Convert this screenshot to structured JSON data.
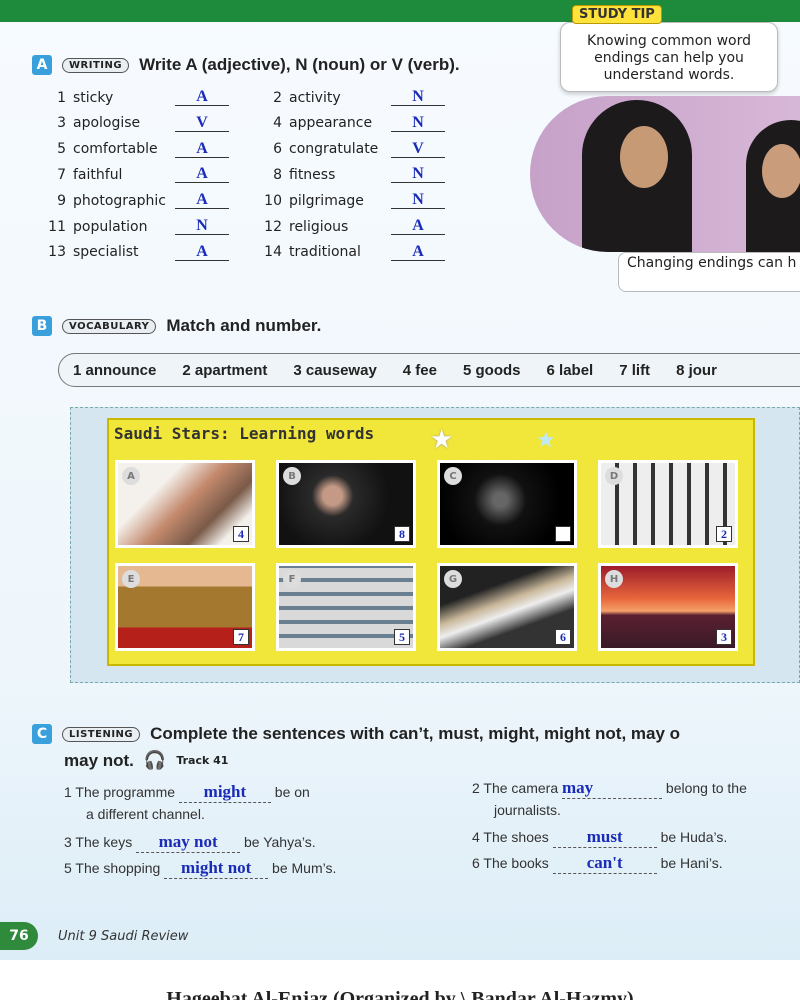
{
  "study_tip": {
    "label": "STUDY TIP",
    "text": "Knowing common word endings can help you understand words.",
    "bubble2": "Changing endings can h you to make new wor"
  },
  "sectionA": {
    "letter": "A",
    "pill": "WRITING",
    "title": "Write A (adjective), N (noun) or V (verb).",
    "items": [
      {
        "n": "1",
        "word": "sticky",
        "ans": "A"
      },
      {
        "n": "2",
        "word": "activity",
        "ans": "N"
      },
      {
        "n": "3",
        "word": "apologise",
        "ans": "V"
      },
      {
        "n": "4",
        "word": "appearance",
        "ans": "N"
      },
      {
        "n": "5",
        "word": "comfortable",
        "ans": "A"
      },
      {
        "n": "6",
        "word": "congratulate",
        "ans": "V"
      },
      {
        "n": "7",
        "word": "faithful",
        "ans": "A"
      },
      {
        "n": "8",
        "word": "fitness",
        "ans": "N"
      },
      {
        "n": "9",
        "word": "photographic",
        "ans": "A"
      },
      {
        "n": "10",
        "word": "pilgrimage",
        "ans": "N"
      },
      {
        "n": "11",
        "word": "population",
        "ans": "N"
      },
      {
        "n": "12",
        "word": "religious",
        "ans": "A"
      },
      {
        "n": "13",
        "word": "specialist",
        "ans": "A"
      },
      {
        "n": "14",
        "word": "traditional",
        "ans": "A"
      }
    ]
  },
  "sectionB": {
    "letter": "B",
    "pill": "VOCABULARY",
    "title": "Match and number.",
    "words": [
      "1 announce",
      "2 apartment",
      "3 causeway",
      "4 fee",
      "5 goods",
      "6 label",
      "7 lift",
      "8 jour"
    ],
    "box_title": "Saudi Stars: Learning words",
    "pictures": [
      {
        "letter": "A",
        "num": "4"
      },
      {
        "letter": "B",
        "num": "8"
      },
      {
        "letter": "C",
        "num": ""
      },
      {
        "letter": "D",
        "num": "2"
      },
      {
        "letter": "E",
        "num": "7"
      },
      {
        "letter": "F",
        "num": "5"
      },
      {
        "letter": "G",
        "num": "6"
      },
      {
        "letter": "H",
        "num": "3"
      }
    ]
  },
  "sectionC": {
    "letter": "C",
    "pill": "LISTENING",
    "title": "Complete the sentences with can’t, must, might, might not, may o",
    "title2": "may not.",
    "track": "Track 41",
    "s1a": "1  The programme",
    "s1ans": "might",
    "s1b": "be on",
    "s1c": "a different channel.",
    "s2a": "2  The camera",
    "s2ans": "may",
    "s2b": "belong to the",
    "s2c": "journalists.",
    "s3a": "3  The keys",
    "s3ans": "may not",
    "s3b": "be Yahya’s.",
    "s4a": "4  The shoes",
    "s4ans": "must",
    "s4b": "be Huda’s.",
    "s5a": "5  The shopping",
    "s5ans": "might not",
    "s5b": "be Mum’s.",
    "s6a": "6  The books",
    "s6ans": "can't",
    "s6b": "be Hani’s."
  },
  "footer": {
    "page": "76",
    "unit": "Unit 9   Saudi Review"
  },
  "credit": "Hageebat Al-Enjaz (Organized by \\ Bandar Al-Hazmy)"
}
